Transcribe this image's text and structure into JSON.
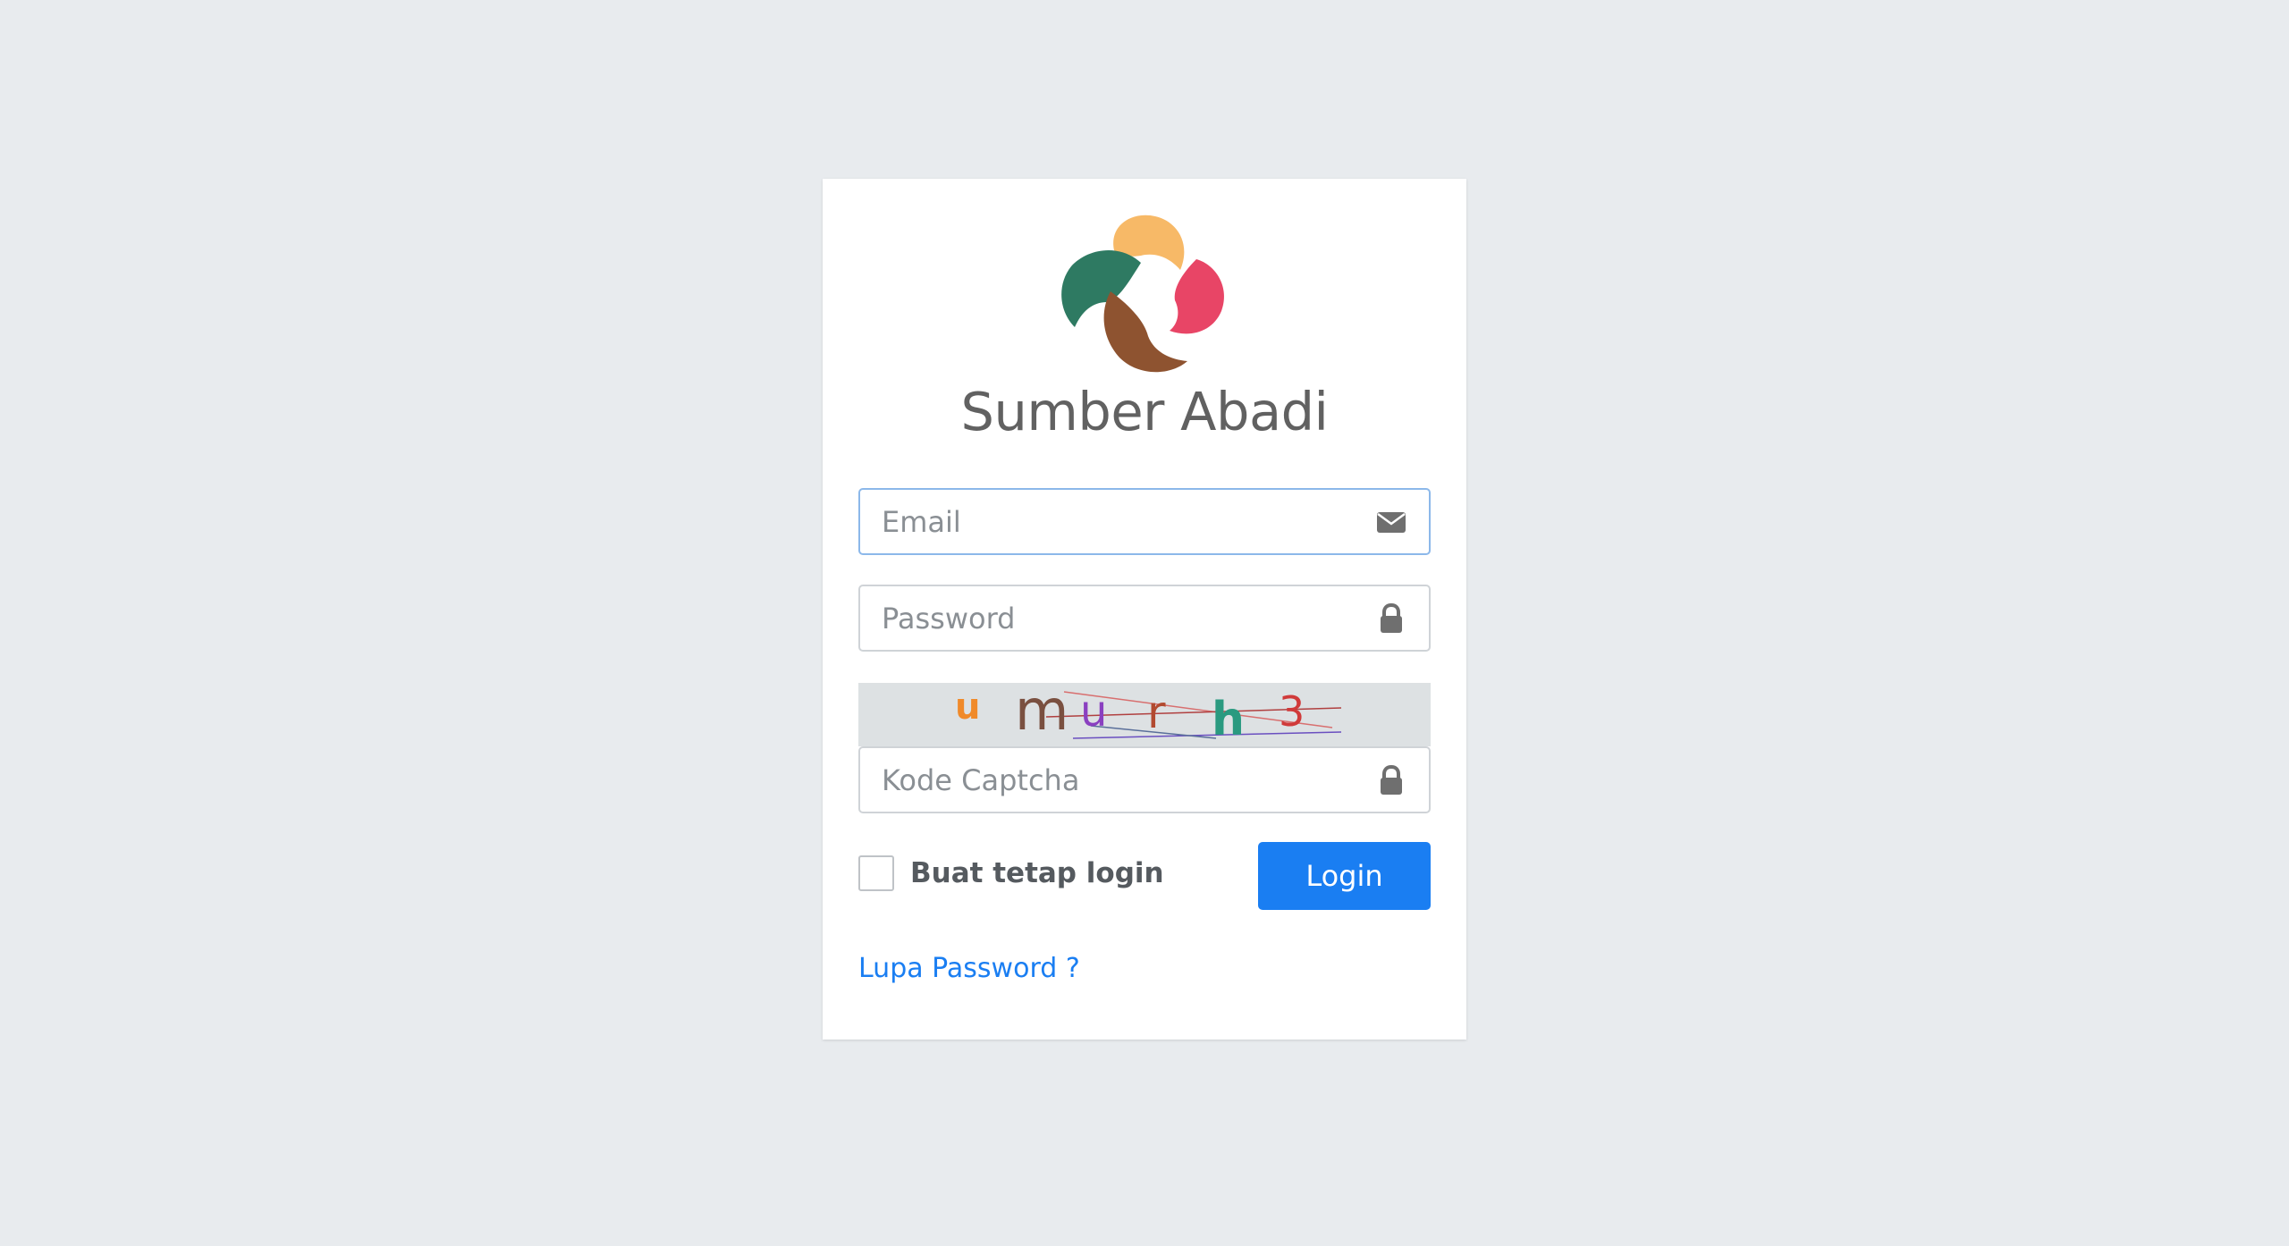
{
  "brand": {
    "name": "Sumber Abadi",
    "logo_colors": [
      "#f7b967",
      "#e84566",
      "#2e7a62",
      "#8e5330"
    ]
  },
  "form": {
    "email_placeholder": "Email",
    "email_value": "",
    "email_icon": "envelope-icon",
    "password_placeholder": "Password",
    "password_value": "",
    "password_icon": "lock-icon",
    "captcha_text": "u m u r h 3",
    "captcha_placeholder": "Kode Captcha",
    "captcha_value": "",
    "captcha_icon": "lock-icon",
    "remember_label": "Buat tetap login",
    "remember_checked": false,
    "login_label": "Login",
    "forgot_label": "Lupa Password ?"
  },
  "colors": {
    "background": "#e8ebee",
    "primary": "#1a7ef2",
    "text_muted": "#616161"
  }
}
